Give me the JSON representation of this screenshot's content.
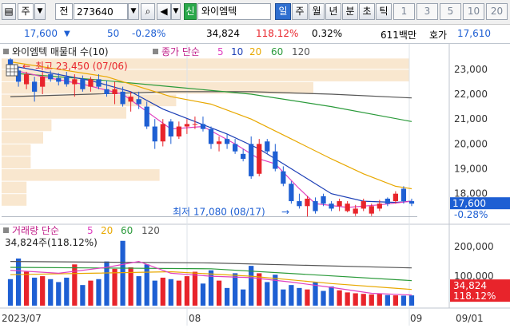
{
  "toolbar": {
    "menu_label": "주",
    "type_label": "전",
    "code_value": "273640",
    "stock_badge": "신",
    "stock_name": "와이엠텍",
    "periods": [
      "일",
      "주",
      "월",
      "년",
      "분",
      "초",
      "틱"
    ],
    "active_period": "일",
    "intervals": [
      "1",
      "3",
      "5",
      "10",
      "20"
    ]
  },
  "info": {
    "price": "17,600",
    "change": "50",
    "change_pct": "-0.28%",
    "volume": "34,824",
    "volume_ratio": "118.12%",
    "turnover": "0.32%",
    "amount": "611백만",
    "quote_label": "호가",
    "quote_price": "17,610"
  },
  "price_panel": {
    "legend_title": "와이엠텍 매물대 수(10)",
    "ma_label": "종가 단순",
    "ma_periods": [
      "5",
      "10",
      "20",
      "60",
      "120"
    ],
    "high_label": "최고 23,450 (07/06)",
    "low_label": "최저 17,080 (08/17)",
    "current_price": "17,600",
    "current_change": "-0.28%",
    "y_ticks": [
      "23,000",
      "22,000",
      "21,000",
      "20,000",
      "19,000",
      "18,000"
    ]
  },
  "volume_panel": {
    "legend_title": "거래량 단순",
    "ma_periods": [
      "5",
      "20",
      "60",
      "120"
    ],
    "subtitle": "34,824주(118.12%)",
    "current_volume": "34,824",
    "current_ratio": "118.12%",
    "y_ticks": [
      "200,000",
      "100,000"
    ]
  },
  "x_labels": [
    "2023/07",
    "08",
    "09",
    "09/01"
  ],
  "colors": {
    "up": "#e8242b",
    "down": "#1e5fd3",
    "ma5": "#e040c0",
    "ma10": "#1c3fb6",
    "ma20": "#e8a800",
    "ma60": "#2a9a3a",
    "ma120": "#555555",
    "supply": "#f9e7cf"
  },
  "chart_data": {
    "type": "candlestick",
    "dates_label_start": "2023/07",
    "candles": [
      {
        "o": 23400,
        "h": 23450,
        "l": 22800,
        "c": 22900
      },
      {
        "o": 22950,
        "h": 23100,
        "l": 22300,
        "c": 22500
      },
      {
        "o": 22400,
        "h": 22900,
        "l": 22200,
        "c": 22800
      },
      {
        "o": 22500,
        "h": 22700,
        "l": 21700,
        "c": 22100
      },
      {
        "o": 22300,
        "h": 22900,
        "l": 22000,
        "c": 22700
      },
      {
        "o": 22800,
        "h": 22950,
        "l": 22500,
        "c": 22600
      },
      {
        "o": 22650,
        "h": 22850,
        "l": 22350,
        "c": 22500
      },
      {
        "o": 22700,
        "h": 22900,
        "l": 22300,
        "c": 22400
      },
      {
        "o": 22400,
        "h": 22800,
        "l": 21900,
        "c": 22600
      },
      {
        "o": 22600,
        "h": 22750,
        "l": 22100,
        "c": 22200
      },
      {
        "o": 22300,
        "h": 22700,
        "l": 22100,
        "c": 22600
      },
      {
        "o": 22600,
        "h": 22800,
        "l": 22200,
        "c": 22300
      },
      {
        "o": 22200,
        "h": 22550,
        "l": 21900,
        "c": 22000
      },
      {
        "o": 22000,
        "h": 22500,
        "l": 21600,
        "c": 22200
      },
      {
        "o": 22100,
        "h": 22300,
        "l": 21500,
        "c": 21600
      },
      {
        "o": 21700,
        "h": 22100,
        "l": 21300,
        "c": 21900
      },
      {
        "o": 21800,
        "h": 22100,
        "l": 21400,
        "c": 21600
      },
      {
        "o": 21500,
        "h": 21700,
        "l": 20600,
        "c": 20700
      },
      {
        "o": 20700,
        "h": 21000,
        "l": 19800,
        "c": 20100
      },
      {
        "o": 20100,
        "h": 21000,
        "l": 19900,
        "c": 20800
      },
      {
        "o": 20900,
        "h": 21000,
        "l": 20000,
        "c": 20300
      },
      {
        "o": 20300,
        "h": 20900,
        "l": 20200,
        "c": 20700
      },
      {
        "o": 20700,
        "h": 21000,
        "l": 20400,
        "c": 20800
      },
      {
        "o": 20800,
        "h": 21100,
        "l": 20600,
        "c": 20800
      },
      {
        "o": 20800,
        "h": 21100,
        "l": 20500,
        "c": 20600
      },
      {
        "o": 20600,
        "h": 20700,
        "l": 19800,
        "c": 20000
      },
      {
        "o": 20000,
        "h": 20300,
        "l": 19700,
        "c": 20100
      },
      {
        "o": 20200,
        "h": 20400,
        "l": 19800,
        "c": 20000
      },
      {
        "o": 20000,
        "h": 20200,
        "l": 19600,
        "c": 19700
      },
      {
        "o": 19600,
        "h": 19800,
        "l": 19300,
        "c": 19400
      },
      {
        "o": 20000,
        "h": 20300,
        "l": 18600,
        "c": 18700
      },
      {
        "o": 18800,
        "h": 20200,
        "l": 18700,
        "c": 20000
      },
      {
        "o": 20100,
        "h": 20200,
        "l": 19600,
        "c": 19700
      },
      {
        "o": 19700,
        "h": 20000,
        "l": 18900,
        "c": 19000
      },
      {
        "o": 18900,
        "h": 19100,
        "l": 18300,
        "c": 18400
      },
      {
        "o": 18400,
        "h": 18500,
        "l": 17600,
        "c": 17700
      },
      {
        "o": 17700,
        "h": 18000,
        "l": 17400,
        "c": 17500
      },
      {
        "o": 17500,
        "h": 17900,
        "l": 17080,
        "c": 17800
      },
      {
        "o": 17700,
        "h": 17850,
        "l": 17200,
        "c": 17300
      },
      {
        "o": 17900,
        "h": 18000,
        "l": 17500,
        "c": 17600
      },
      {
        "o": 17600,
        "h": 17700,
        "l": 17300,
        "c": 17400
      },
      {
        "o": 17500,
        "h": 17800,
        "l": 17300,
        "c": 17700
      },
      {
        "o": 17300,
        "h": 17700,
        "l": 17250,
        "c": 17600
      },
      {
        "o": 17200,
        "h": 17550,
        "l": 17100,
        "c": 17400
      },
      {
        "o": 17400,
        "h": 17800,
        "l": 17300,
        "c": 17700
      },
      {
        "o": 17200,
        "h": 17600,
        "l": 17100,
        "c": 17500
      },
      {
        "o": 17400,
        "h": 17750,
        "l": 17300,
        "c": 17600
      },
      {
        "o": 17800,
        "h": 17850,
        "l": 17500,
        "c": 17600
      },
      {
        "o": 17700,
        "h": 18100,
        "l": 17600,
        "c": 18000
      },
      {
        "o": 18200,
        "h": 18300,
        "l": 17600,
        "c": 17700
      },
      {
        "o": 17700,
        "h": 17800,
        "l": 17500,
        "c": 17600
      }
    ],
    "volumes": [
      90000,
      160000,
      115000,
      95000,
      100000,
      90000,
      80000,
      95000,
      140000,
      70000,
      85000,
      90000,
      150000,
      125000,
      220000,
      130000,
      100000,
      140000,
      85000,
      95000,
      90000,
      85000,
      100000,
      115000,
      75000,
      120000,
      85000,
      60000,
      110000,
      55000,
      135000,
      110000,
      80000,
      105000,
      55000,
      70000,
      60000,
      55000,
      80000,
      50000,
      65000,
      52000,
      45000,
      42000,
      40000,
      38000,
      40000,
      36000,
      35000,
      34000,
      34824
    ],
    "ma": {
      "ma5": [
        [
          0,
          23000
        ],
        [
          4,
          22700
        ],
        [
          9,
          22400
        ],
        [
          14,
          22000
        ],
        [
          17,
          21300
        ],
        [
          20,
          20600
        ],
        [
          24,
          20700
        ],
        [
          28,
          20000
        ],
        [
          31,
          19400
        ],
        [
          33,
          19200
        ],
        [
          36,
          18200
        ],
        [
          38,
          17600
        ],
        [
          42,
          17450
        ],
        [
          46,
          17550
        ],
        [
          50,
          17700
        ]
      ],
      "ma10": [
        [
          0,
          23150
        ],
        [
          5,
          22850
        ],
        [
          10,
          22550
        ],
        [
          15,
          22100
        ],
        [
          19,
          21400
        ],
        [
          23,
          20900
        ],
        [
          27,
          20400
        ],
        [
          31,
          19800
        ],
        [
          34,
          19200
        ],
        [
          37,
          18600
        ],
        [
          40,
          18000
        ],
        [
          44,
          17700
        ],
        [
          48,
          17650
        ],
        [
          50,
          17700
        ]
      ],
      "ma20": [
        [
          0,
          23300
        ],
        [
          6,
          23000
        ],
        [
          12,
          22700
        ],
        [
          16,
          22300
        ],
        [
          20,
          21900
        ],
        [
          25,
          21600
        ],
        [
          30,
          21000
        ],
        [
          35,
          20200
        ],
        [
          40,
          19400
        ],
        [
          44,
          18800
        ],
        [
          48,
          18300
        ],
        [
          50,
          18200
        ]
      ],
      "ma60": [
        [
          0,
          22850
        ],
        [
          10,
          22600
        ],
        [
          20,
          22300
        ],
        [
          30,
          22000
        ],
        [
          40,
          21500
        ],
        [
          50,
          20900
        ]
      ],
      "ma120": [
        [
          0,
          21900
        ],
        [
          10,
          22000
        ],
        [
          20,
          22100
        ],
        [
          30,
          22100
        ],
        [
          40,
          22000
        ],
        [
          50,
          21850
        ]
      ]
    },
    "volume_ma": {
      "ma5": [
        [
          0,
          120000
        ],
        [
          6,
          110000
        ],
        [
          12,
          130000
        ],
        [
          16,
          150000
        ],
        [
          20,
          110000
        ],
        [
          25,
          100000
        ],
        [
          30,
          95000
        ],
        [
          35,
          80000
        ],
        [
          40,
          62000
        ],
        [
          45,
          42000
        ],
        [
          50,
          36000
        ]
      ],
      "ma20": [
        [
          0,
          105000
        ],
        [
          10,
          110000
        ],
        [
          20,
          115000
        ],
        [
          30,
          100000
        ],
        [
          40,
          75000
        ],
        [
          50,
          55000
        ]
      ],
      "ma60": [
        [
          0,
          130000
        ],
        [
          25,
          125000
        ],
        [
          50,
          85000
        ]
      ],
      "ma120": [
        [
          0,
          150000
        ],
        [
          25,
          145000
        ],
        [
          50,
          128000
        ]
      ]
    },
    "supply_zones": [
      {
        "low": 23000,
        "high": 23450,
        "width": 0.98
      },
      {
        "low": 22500,
        "high": 23000,
        "width": 0.98
      },
      {
        "low": 22000,
        "high": 22500,
        "width": 0.75
      },
      {
        "low": 21500,
        "high": 22000,
        "width": 0.42
      },
      {
        "low": 21000,
        "high": 21500,
        "width": 0.3
      },
      {
        "low": 20500,
        "high": 21000,
        "width": 0.12
      },
      {
        "low": 20000,
        "high": 20500,
        "width": 0.1
      },
      {
        "low": 19500,
        "high": 20000,
        "width": 0.07
      },
      {
        "low": 19000,
        "high": 19500,
        "width": 0.07
      },
      {
        "low": 18500,
        "high": 19000,
        "width": 0.38
      },
      {
        "low": 18000,
        "high": 18500,
        "width": 0.06
      },
      {
        "low": 17500,
        "high": 18000,
        "width": 0.06
      }
    ],
    "price_range": [
      16900,
      23700
    ],
    "volume_range": [
      0,
      260000
    ]
  }
}
